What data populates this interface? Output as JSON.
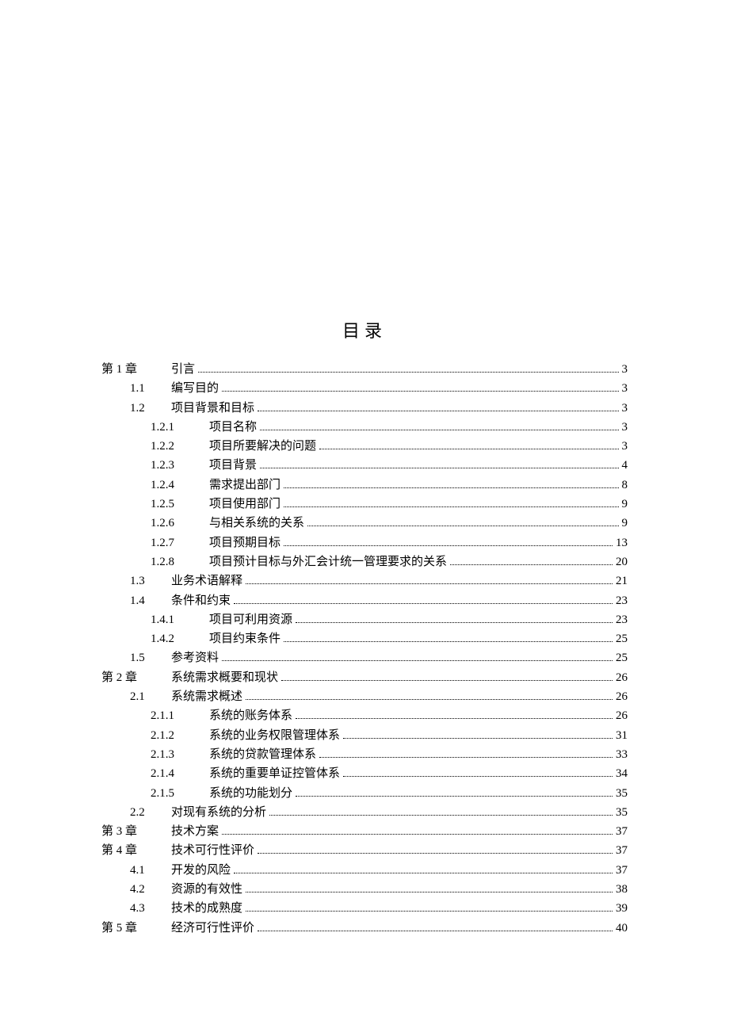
{
  "title": "目录",
  "entries": [
    {
      "level": 0,
      "num": "第 1 章",
      "text": "引言",
      "page": "3"
    },
    {
      "level": 1,
      "num": "1.1",
      "text": "编写目的",
      "page": "3"
    },
    {
      "level": 1,
      "num": "1.2",
      "text": "项目背景和目标",
      "page": "3"
    },
    {
      "level": 2,
      "num": "1.2.1",
      "text": "项目名称",
      "page": "3"
    },
    {
      "level": 2,
      "num": "1.2.2",
      "text": "项目所要解决的问题",
      "page": "3"
    },
    {
      "level": 2,
      "num": "1.2.3",
      "text": "项目背景",
      "page": "4"
    },
    {
      "level": 2,
      "num": "1.2.4",
      "text": "需求提出部门",
      "page": "8"
    },
    {
      "level": 2,
      "num": "1.2.5",
      "text": "项目使用部门",
      "page": "9"
    },
    {
      "level": 2,
      "num": "1.2.6",
      "text": "与相关系统的关系",
      "page": "9"
    },
    {
      "level": 2,
      "num": "1.2.7",
      "text": "项目预期目标",
      "page": "13"
    },
    {
      "level": 2,
      "num": "1.2.8",
      "text": "项目预计目标与外汇会计统一管理要求的关系",
      "page": "20"
    },
    {
      "level": 1,
      "num": "1.3",
      "text": "业务术语解释",
      "page": "21"
    },
    {
      "level": 1,
      "num": "1.4",
      "text": "条件和约束",
      "page": "23"
    },
    {
      "level": 2,
      "num": "1.4.1",
      "text": "项目可利用资源",
      "page": "23"
    },
    {
      "level": 2,
      "num": "1.4.2",
      "text": "项目约束条件",
      "page": "25"
    },
    {
      "level": 1,
      "num": "1.5",
      "text": "参考资料",
      "page": "25"
    },
    {
      "level": 0,
      "num": "第 2 章",
      "text": "系统需求概要和现状",
      "page": "26"
    },
    {
      "level": 1,
      "num": "2.1",
      "text": "系统需求概述",
      "page": "26"
    },
    {
      "level": 2,
      "num": "2.1.1",
      "text": "系统的账务体系",
      "page": "26"
    },
    {
      "level": 2,
      "num": "2.1.2",
      "text": "系统的业务权限管理体系",
      "page": "31"
    },
    {
      "level": 2,
      "num": "2.1.3",
      "text": "系统的贷款管理体系",
      "page": "33"
    },
    {
      "level": 2,
      "num": "2.1.4",
      "text": "系统的重要单证控管体系",
      "page": "34"
    },
    {
      "level": 2,
      "num": "2.1.5",
      "text": "系统的功能划分",
      "page": "35"
    },
    {
      "level": 1,
      "num": "2.2",
      "text": "对现有系统的分析",
      "page": "35"
    },
    {
      "level": 0,
      "num": "第 3 章",
      "text": "技术方案",
      "page": "37"
    },
    {
      "level": 0,
      "num": "第 4 章",
      "text": "技术可行性评价",
      "page": "37"
    },
    {
      "level": 1,
      "num": "4.1",
      "text": "开发的风险",
      "page": "37"
    },
    {
      "level": 1,
      "num": "4.2",
      "text": "资源的有效性",
      "page": "38"
    },
    {
      "level": 1,
      "num": "4.3",
      "text": "技术的成熟度",
      "page": "39"
    },
    {
      "level": 0,
      "num": "第 5 章",
      "text": "经济可行性评价",
      "page": "40"
    }
  ]
}
